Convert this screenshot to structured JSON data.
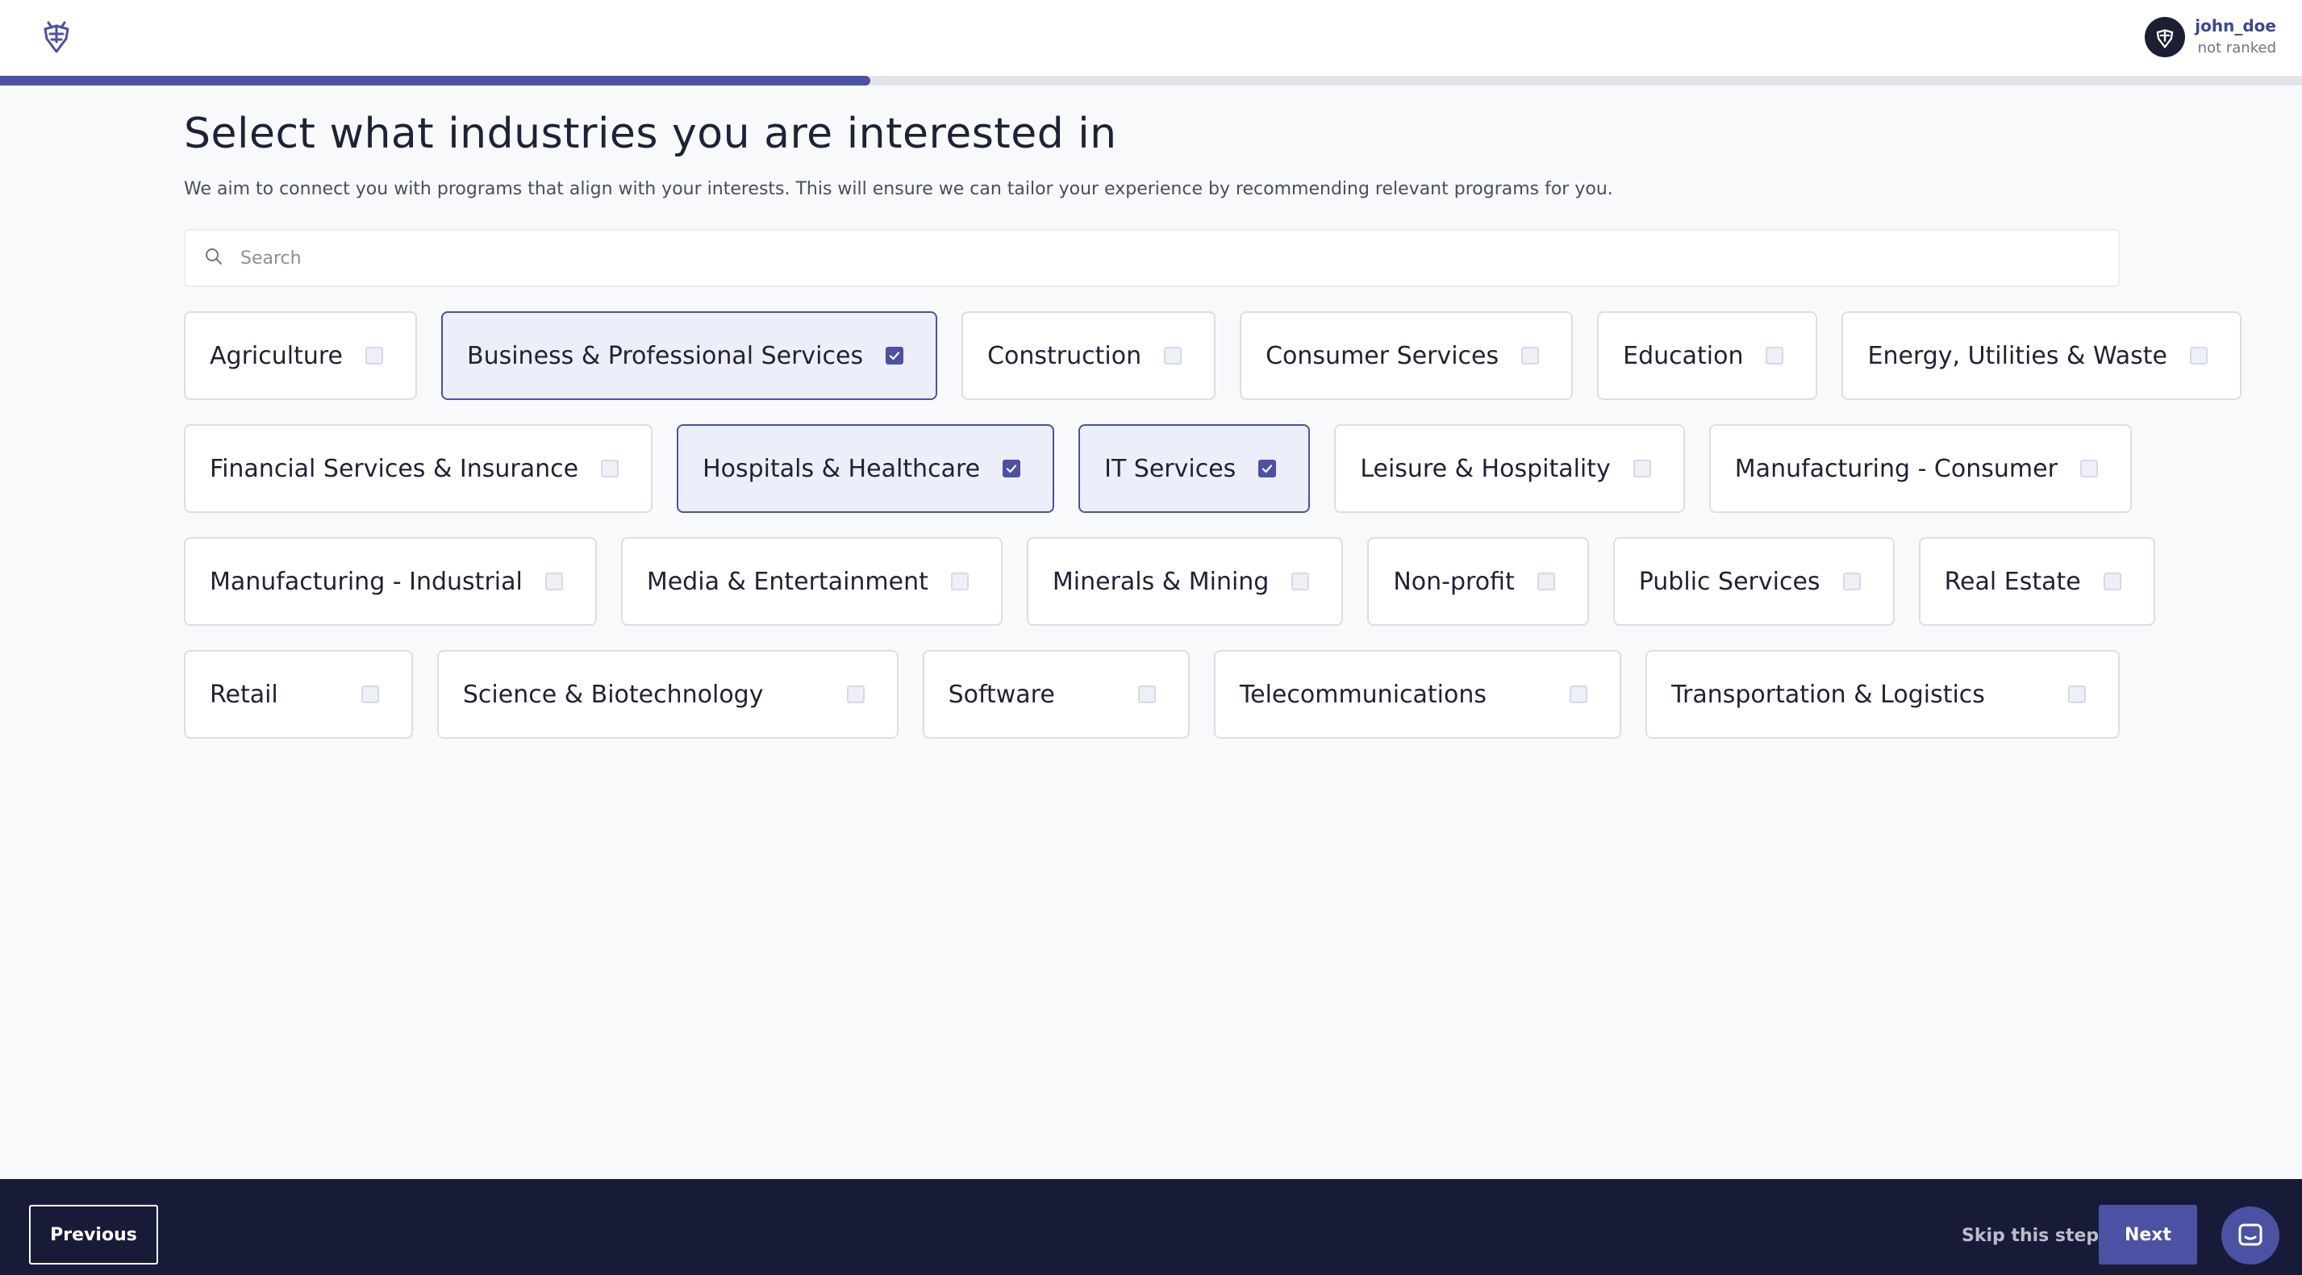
{
  "header": {
    "logo_icon": "bee-shield-icon",
    "username": "john_doe",
    "rank": "not ranked",
    "avatar_icon": "bee-shield-icon"
  },
  "progress": {
    "fraction": 0.378
  },
  "page": {
    "title": "Select what industries you are interested in",
    "subtitle": "We aim to connect you with programs that align with your interests. This will ensure we can tailor your experience by recommending relevant programs for you."
  },
  "search": {
    "placeholder": "Search",
    "value": "",
    "icon": "search-icon"
  },
  "industries": [
    [
      {
        "label": "Agriculture",
        "selected": false
      },
      {
        "label": "Business & Professional Services",
        "selected": true
      },
      {
        "label": "Construction",
        "selected": false
      },
      {
        "label": "Consumer Services",
        "selected": false
      },
      {
        "label": "Education",
        "selected": false
      },
      {
        "label": "Energy, Utilities & Waste",
        "selected": false
      }
    ],
    [
      {
        "label": "Financial Services & Insurance",
        "selected": false
      },
      {
        "label": "Hospitals & Healthcare",
        "selected": true
      },
      {
        "label": "IT Services",
        "selected": true
      },
      {
        "label": "Leisure & Hospitality",
        "selected": false
      },
      {
        "label": "Manufacturing - Consumer",
        "selected": false
      }
    ],
    [
      {
        "label": "Manufacturing - Industrial",
        "selected": false
      },
      {
        "label": "Media & Entertainment",
        "selected": false
      },
      {
        "label": "Minerals & Mining",
        "selected": false
      },
      {
        "label": "Non-profit",
        "selected": false
      },
      {
        "label": "Public Services",
        "selected": false
      },
      {
        "label": "Real Estate",
        "selected": false
      }
    ],
    [
      {
        "label": "Retail",
        "selected": false
      },
      {
        "label": "Science & Biotechnology",
        "selected": false
      },
      {
        "label": "Software",
        "selected": false
      },
      {
        "label": "Telecommunications",
        "selected": false
      },
      {
        "label": "Transportation & Logistics",
        "selected": false
      }
    ]
  ],
  "footer": {
    "previous_label": "Previous",
    "skip_label": "Skip this step",
    "next_label": "Next",
    "chat_icon": "chat-icon"
  },
  "colors": {
    "accent": "#4b52a3",
    "footer_bg": "#181b38",
    "selected_bg": "#eceef9"
  }
}
